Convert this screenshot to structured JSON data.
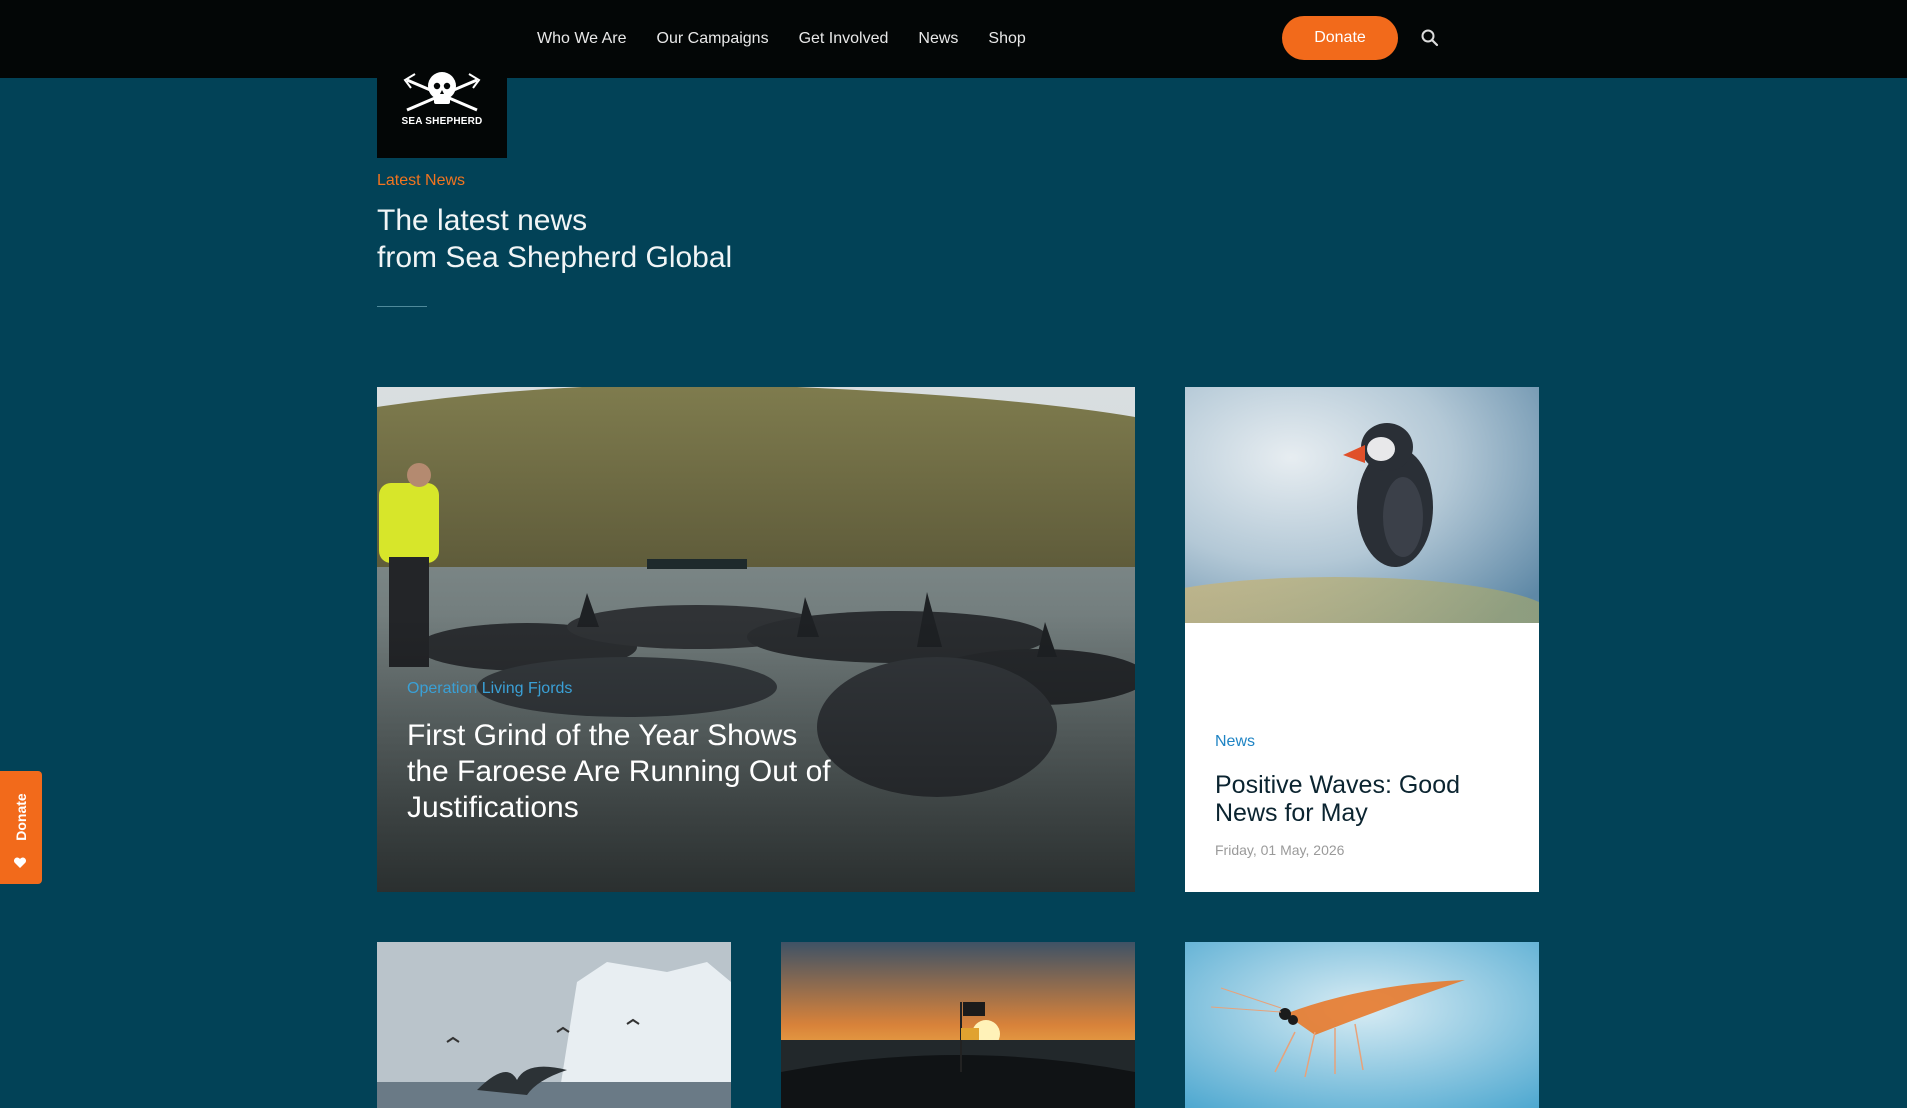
{
  "header": {
    "nav": [
      {
        "label": "Who We Are"
      },
      {
        "label": "Our Campaigns"
      },
      {
        "label": "Get Involved"
      },
      {
        "label": "News"
      },
      {
        "label": "Shop"
      }
    ],
    "donate_label": "Donate",
    "search_icon": "search-icon",
    "logo_text": "SEA SHEPHERD"
  },
  "hero": {
    "eyebrow": "Latest News",
    "title_line1": "The latest news",
    "title_line2": "from Sea Shepherd Global"
  },
  "feature": {
    "tag": "Operation Living Fjords",
    "title": "First Grind of the Year Shows the Faroese Are Running Out of Justifications"
  },
  "side_card": {
    "tag": "News",
    "title": "Positive Waves: Good News for May",
    "date": "Friday, 01 May, 2026"
  },
  "float_donate": {
    "label": "Donate"
  },
  "colors": {
    "background": "#024257",
    "accent": "#f26a1b",
    "link": "#1f84c4"
  }
}
